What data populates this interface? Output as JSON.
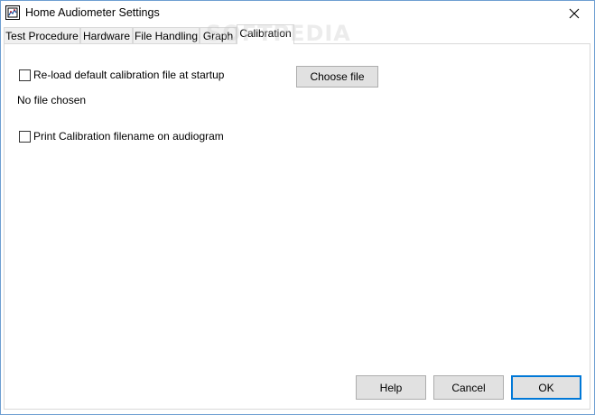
{
  "window": {
    "title": "Home Audiometer Settings"
  },
  "tabs": [
    {
      "label": "Test Procedure"
    },
    {
      "label": "Hardware"
    },
    {
      "label": "File Handling"
    },
    {
      "label": "Graph"
    },
    {
      "label": "Calibration"
    }
  ],
  "active_tab": "Calibration",
  "calibration": {
    "reload_label": "Re-load default calibration file at startup",
    "reload_checked": false,
    "choose_file_label": "Choose file",
    "file_status": "No file chosen",
    "print_label": "Print Calibration filename on audiogram",
    "print_checked": false
  },
  "footer": {
    "help_label": "Help",
    "cancel_label": "Cancel",
    "ok_label": "OK"
  },
  "watermark": "SOFTPEDIA"
}
